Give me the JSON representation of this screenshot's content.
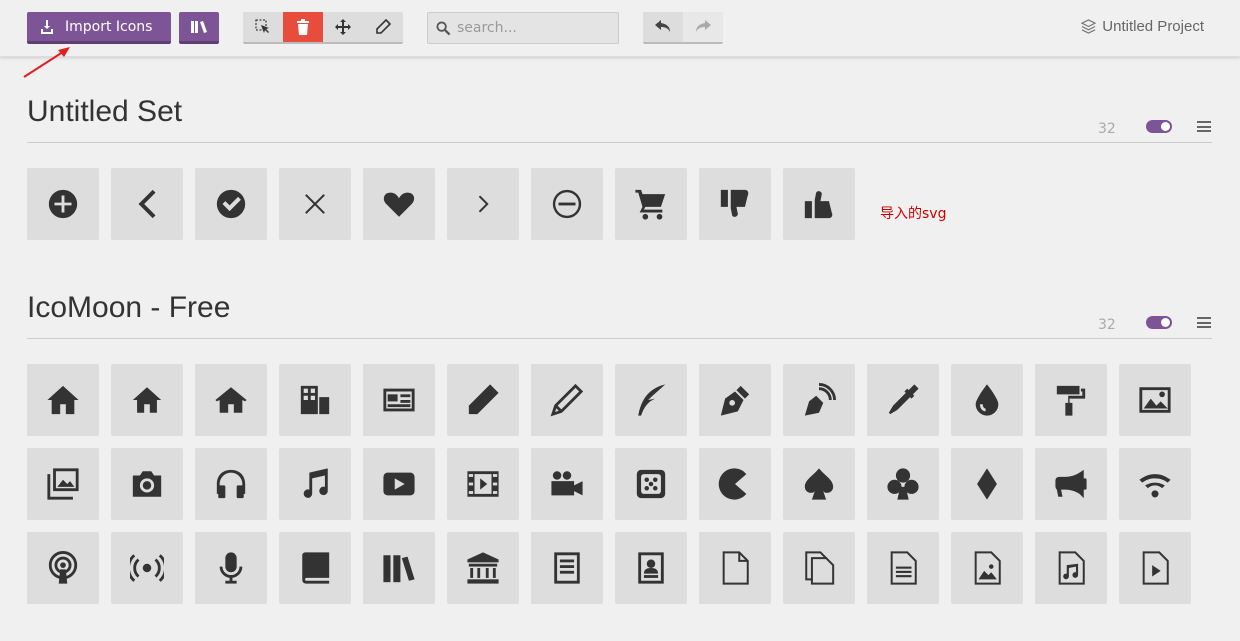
{
  "toolbar": {
    "import_label": "Import Icons",
    "search_placeholder": "search...",
    "project_name": "Untitled Project"
  },
  "sets": [
    {
      "title": "Untitled Set",
      "count": "32",
      "note": "导入的svg",
      "icons": [
        "add-circle-icon",
        "chevron-left-icon",
        "check-circle-icon",
        "close-icon",
        "heart-icon",
        "chevron-right-icon",
        "minus-circle-icon",
        "cart-icon",
        "thumbs-down-icon",
        "thumbs-up-icon"
      ]
    },
    {
      "title": "IcoMoon - Free",
      "count": "32",
      "icons": [
        "home-icon",
        "home2-icon",
        "home3-icon",
        "office-icon",
        "newspaper-icon",
        "pencil-icon",
        "pencil2-icon",
        "quill-icon",
        "pen-icon",
        "blog-icon",
        "eyedropper-icon",
        "droplet-icon",
        "paint-format-icon",
        "image-icon",
        "images-icon",
        "camera-icon",
        "headphones-icon",
        "music-icon",
        "play-icon",
        "film-icon",
        "video-camera-icon",
        "dice-icon",
        "pacman-icon",
        "spades-icon",
        "clubs-icon",
        "diamonds-icon",
        "bullhorn-icon",
        "connection-icon",
        "podcast-icon",
        "feed-icon",
        "mic-icon",
        "book-icon",
        "books-icon",
        "library-icon",
        "file-text-icon",
        "profile-icon",
        "file-empty-icon",
        "files-empty-icon",
        "file-text2-icon",
        "file-picture-icon",
        "file-music-icon",
        "file-play-icon"
      ]
    }
  ],
  "colors": {
    "accent": "#7d5596",
    "danger": "#e74c3c",
    "note": "#cc0000"
  }
}
